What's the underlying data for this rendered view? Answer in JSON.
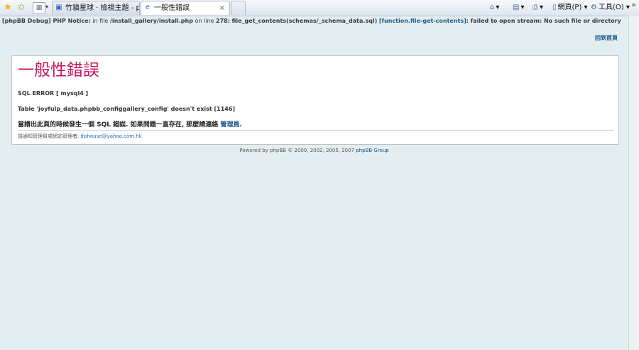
{
  "browser": {
    "tabs": [
      {
        "label": "竹貓星球 ‧ 檢視主題 - ph...",
        "active": false
      },
      {
        "label": "一般性錯誤",
        "active": true
      }
    ],
    "commands": {
      "page": "網頁(P)",
      "tools": "工具(O)"
    }
  },
  "debug": {
    "prefix": "[phpBB Debug] PHP Notice:",
    "in_file": "in file",
    "file": "/install_gallery/install.php",
    "on_line": "on line",
    "line": "278:",
    "call": "file_get_contents(schemas/_schema_data.sql)",
    "link": "[function.file-get-contents]",
    "message": ": failed to open stream: No such file or directory"
  },
  "header": {
    "home_link": "回到首頁"
  },
  "error": {
    "title": "一般性錯誤",
    "sql_error": "SQL ERROR [ mysql4 ]",
    "table_msg": "Table 'joyfulp_data.phpbb_configgallery_config' doesn't exist [1146]",
    "message": "當請出此頁的時候發生一個 SQL 錯誤. 如果問題一直存在, 那麼請連絡",
    "admin_link": "管理員",
    "message_end": ".",
    "footer_prefix": "請通知管理員或網站管理者:",
    "footer_email": "jfphouse@yahoo.com.hk"
  },
  "footer": {
    "powered": "Powered by phpBB © 2000, 2002, 2005, 2007",
    "group": "phpBB Group"
  }
}
